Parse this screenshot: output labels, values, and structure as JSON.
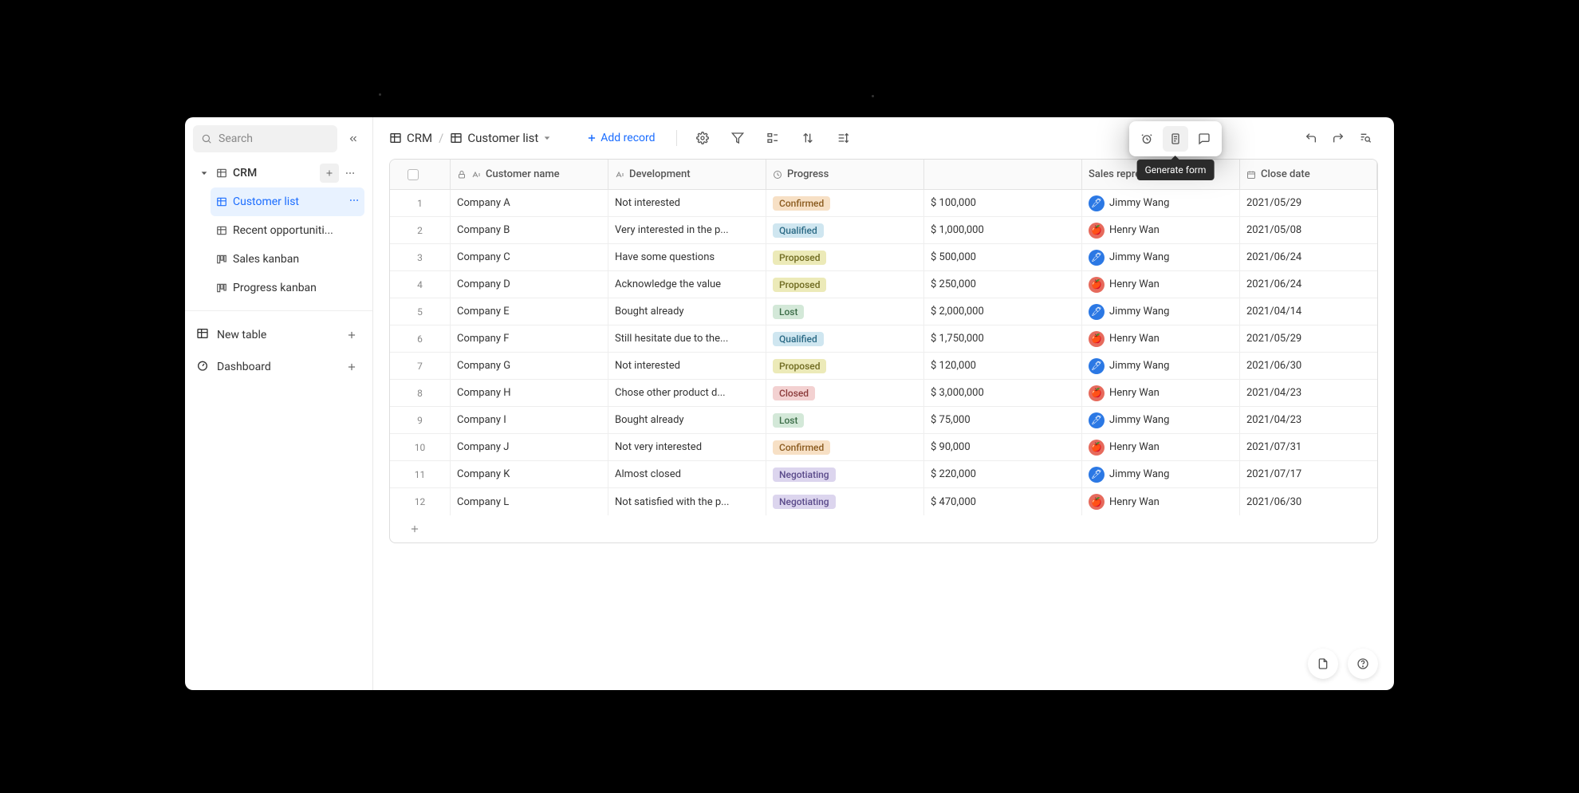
{
  "sidebar": {
    "search_placeholder": "Search",
    "workspace": "CRM",
    "items": [
      {
        "label": "Customer list",
        "icon": "table",
        "selected": true
      },
      {
        "label": "Recent opportuniti...",
        "icon": "table"
      },
      {
        "label": "Sales kanban",
        "icon": "kanban"
      },
      {
        "label": "Progress kanban",
        "icon": "kanban"
      }
    ],
    "new_table": "New table",
    "dashboard": "Dashboard"
  },
  "breadcrumb": {
    "a": "CRM",
    "b": "Customer list"
  },
  "toolbar": {
    "add_record": "Add record",
    "tooltip": "Generate form"
  },
  "table": {
    "columns": {
      "customer_name": "Customer name",
      "development": "Development",
      "progress": "Progress",
      "deal_value": "",
      "sales_rep": "Sales representatives",
      "close_date": "Close date"
    },
    "rows": [
      {
        "idx": "1",
        "name": "Company A",
        "dev": "Not interested",
        "prog": "Confirmed",
        "deal": "$ 100,000",
        "rep": "Jimmy Wang",
        "rep_av": "blue",
        "date": "2021/05/29"
      },
      {
        "idx": "2",
        "name": "Company B",
        "dev": "Very interested in the p...",
        "prog": "Qualified",
        "deal": "$ 1,000,000",
        "rep": "Henry Wan",
        "rep_av": "red",
        "date": "2021/05/08"
      },
      {
        "idx": "3",
        "name": "Company C",
        "dev": "Have some questions",
        "prog": "Proposed",
        "deal": "$ 500,000",
        "rep": "Jimmy Wang",
        "rep_av": "blue",
        "date": "2021/06/24"
      },
      {
        "idx": "4",
        "name": "Company D",
        "dev": "Acknowledge the value",
        "prog": "Proposed",
        "deal": "$ 250,000",
        "rep": "Henry Wan",
        "rep_av": "red",
        "date": "2021/06/24"
      },
      {
        "idx": "5",
        "name": "Company E",
        "dev": "Bought already",
        "prog": "Lost",
        "deal": "$ 2,000,000",
        "rep": "Jimmy Wang",
        "rep_av": "blue",
        "date": "2021/04/14"
      },
      {
        "idx": "6",
        "name": "Company F",
        "dev": "Still hesitate due to the...",
        "prog": "Qualified",
        "deal": "$ 1,750,000",
        "rep": "Henry Wan",
        "rep_av": "red",
        "date": "2021/05/29"
      },
      {
        "idx": "7",
        "name": "Company G",
        "dev": "Not interested",
        "prog": "Proposed",
        "deal": "$ 120,000",
        "rep": "Jimmy Wang",
        "rep_av": "blue",
        "date": "2021/06/30"
      },
      {
        "idx": "8",
        "name": "Company H",
        "dev": "Chose other product d...",
        "prog": "Closed",
        "deal": "$ 3,000,000",
        "rep": "Henry Wan",
        "rep_av": "red",
        "date": "2021/04/23"
      },
      {
        "idx": "9",
        "name": "Company I",
        "dev": "Bought already",
        "prog": "Lost",
        "deal": "$ 75,000",
        "rep": "Jimmy Wang",
        "rep_av": "blue",
        "date": "2021/04/23"
      },
      {
        "idx": "10",
        "name": "Company J",
        "dev": "Not very interested",
        "prog": "Confirmed",
        "deal": "$ 90,000",
        "rep": "Henry Wan",
        "rep_av": "red",
        "date": "2021/07/31"
      },
      {
        "idx": "11",
        "name": "Company K",
        "dev": "Almost closed",
        "prog": "Negotiating",
        "deal": "$ 220,000",
        "rep": "Jimmy Wang",
        "rep_av": "blue",
        "date": "2021/07/17"
      },
      {
        "idx": "12",
        "name": "Company L",
        "dev": "Not satisfied with the p...",
        "prog": "Negotiating",
        "deal": "$ 470,000",
        "rep": "Henry Wan",
        "rep_av": "red",
        "date": "2021/06/30"
      }
    ]
  },
  "tag_class": {
    "Confirmed": "tag-confirmed",
    "Qualified": "tag-qualified",
    "Proposed": "tag-proposed",
    "Lost": "tag-lost",
    "Closed": "tag-closed",
    "Negotiating": "tag-negotiating"
  }
}
